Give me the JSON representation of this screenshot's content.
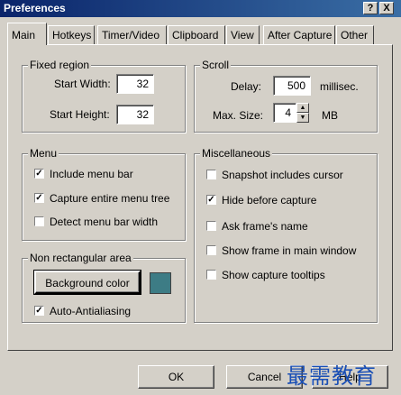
{
  "window": {
    "title": "Preferences",
    "help_btn": "?",
    "close_btn": "X"
  },
  "tabs": [
    "Main",
    "Hotkeys",
    "Timer/Video",
    "Clipboard",
    "View",
    "After Capture",
    "Other"
  ],
  "fixed_region": {
    "title": "Fixed region",
    "start_width_label": "Start Width:",
    "start_width_value": "32",
    "start_height_label": "Start Height:",
    "start_height_value": "32"
  },
  "scroll": {
    "title": "Scroll",
    "delay_label": "Delay:",
    "delay_value": "500",
    "delay_unit": "millisec.",
    "max_size_label": "Max. Size:",
    "max_size_value": "4",
    "max_size_unit": "MB"
  },
  "menu": {
    "title": "Menu",
    "items": [
      {
        "label": "Include menu bar",
        "checked": true
      },
      {
        "label": "Capture entire menu tree",
        "checked": true
      },
      {
        "label": "Detect menu bar width",
        "checked": false
      }
    ]
  },
  "misc": {
    "title": "Miscellaneous",
    "items": [
      {
        "label": "Snapshot includes cursor",
        "checked": false
      },
      {
        "label": "Hide before capture",
        "checked": true
      },
      {
        "label": "Ask frame's name",
        "checked": false
      },
      {
        "label": "Show frame in main window",
        "checked": false
      },
      {
        "label": "Show capture tooltips",
        "checked": false
      }
    ]
  },
  "nonrect": {
    "title": "Non rectangular area",
    "bg_button": "Background color",
    "swatch_color": "#3d7c85",
    "antialias_label": "Auto-Antialiasing",
    "antialias_checked": true
  },
  "footer": {
    "ok": "OK",
    "cancel": "Cancel",
    "help": "Help"
  },
  "watermark": "最需教育"
}
